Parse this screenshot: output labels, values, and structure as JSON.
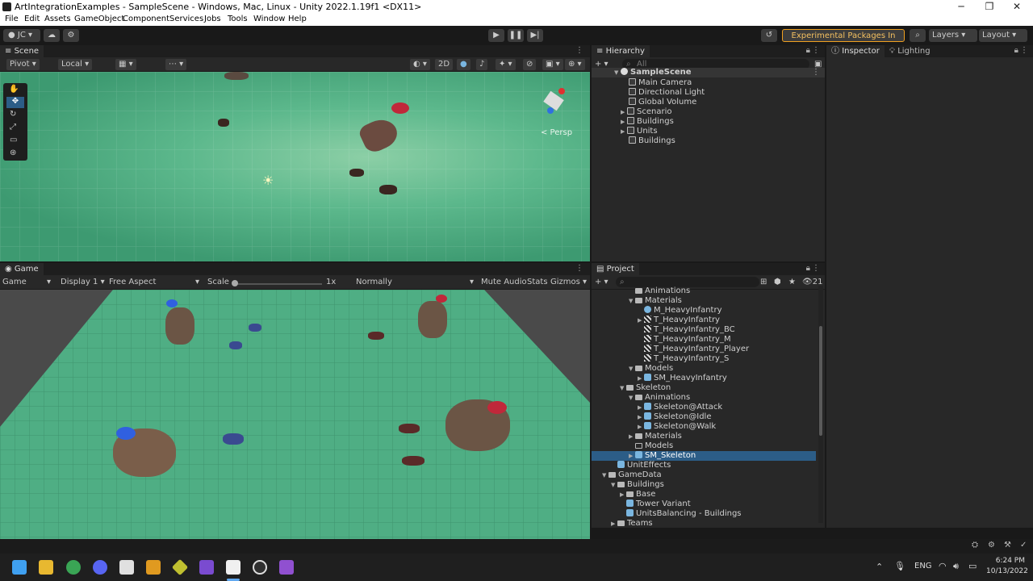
{
  "window": {
    "title": "ArtIntegrationExamples - SampleScene - Windows, Mac, Linux - Unity 2022.1.19f1 <DX11>",
    "minimize": "─",
    "maximize": "❐",
    "close": "✕"
  },
  "menu": [
    "File",
    "Edit",
    "Assets",
    "GameObject",
    "Component",
    "Services",
    "Jobs",
    "Tools",
    "Window",
    "Help"
  ],
  "toolbar": {
    "account": "JC",
    "experimental": "Experimental Packages In Use",
    "layers": "Layers",
    "layout": "Layout"
  },
  "scene": {
    "tab": "Scene",
    "pivot": "Pivot",
    "local": "Local",
    "mode_2d": "2D",
    "persp": "< Persp"
  },
  "game": {
    "tab": "Game",
    "mode": "Game",
    "display": "Display 1",
    "aspect": "Free Aspect",
    "scale_label": "Scale",
    "scale_value": "1x",
    "vsync": "Normally",
    "mute": "Mute Audio",
    "stats": "Stats",
    "gizmos": "Gizmos"
  },
  "hierarchy": {
    "tab": "Hierarchy",
    "search": "All",
    "scene": "SampleScene",
    "items": [
      "Main Camera",
      "Directional Light",
      "Global Volume",
      "Scenario",
      "Buildings",
      "Units",
      "Buildings"
    ]
  },
  "project": {
    "tab": "Project",
    "count": "21",
    "rows": [
      {
        "label": "Animations",
        "depth": 4,
        "icon": "folder",
        "arrow": ""
      },
      {
        "label": "Materials",
        "depth": 4,
        "icon": "folder",
        "arrow": "▼"
      },
      {
        "label": "M_HeavyInfantry",
        "depth": 5,
        "icon": "material",
        "arrow": ""
      },
      {
        "label": "T_HeavyInfantry",
        "depth": 5,
        "icon": "texture",
        "arrow": "▶"
      },
      {
        "label": "T_HeavyInfantry_BC",
        "depth": 5,
        "icon": "texture",
        "arrow": ""
      },
      {
        "label": "T_HeavyInfantry_M",
        "depth": 5,
        "icon": "texture",
        "arrow": ""
      },
      {
        "label": "T_HeavyInfantry_Player",
        "depth": 5,
        "icon": "texture",
        "arrow": ""
      },
      {
        "label": "T_HeavyInfantry_S",
        "depth": 5,
        "icon": "texture",
        "arrow": ""
      },
      {
        "label": "Models",
        "depth": 4,
        "icon": "folder",
        "arrow": "▼"
      },
      {
        "label": "SM_HeavyInfantry",
        "depth": 5,
        "icon": "prefab",
        "arrow": "▶"
      },
      {
        "label": "Skeleton",
        "depth": 3,
        "icon": "folder",
        "arrow": "▼"
      },
      {
        "label": "Animations",
        "depth": 4,
        "icon": "folder",
        "arrow": "▼"
      },
      {
        "label": "Skeleton@Attack",
        "depth": 5,
        "icon": "prefab",
        "arrow": "▶"
      },
      {
        "label": "Skeleton@Idle",
        "depth": 5,
        "icon": "prefab",
        "arrow": "▶"
      },
      {
        "label": "Skeleton@Walk",
        "depth": 5,
        "icon": "prefab",
        "arrow": "▶"
      },
      {
        "label": "Materials",
        "depth": 4,
        "icon": "folder",
        "arrow": "▶"
      },
      {
        "label": "Models",
        "depth": 4,
        "icon": "folder-open",
        "arrow": ""
      },
      {
        "label": "SM_Skeleton",
        "depth": 4,
        "icon": "prefab",
        "arrow": "▶"
      },
      {
        "label": "UnitEffects",
        "depth": 2,
        "icon": "prefab",
        "arrow": ""
      },
      {
        "label": "GameData",
        "depth": 1,
        "icon": "folder",
        "arrow": "▼"
      },
      {
        "label": "Buildings",
        "depth": 2,
        "icon": "folder",
        "arrow": "▼"
      },
      {
        "label": "Base",
        "depth": 3,
        "icon": "folder",
        "arrow": "▶"
      },
      {
        "label": "Tower Variant",
        "depth": 3,
        "icon": "prefab",
        "arrow": ""
      },
      {
        "label": "UnitsBalancing - Buildings",
        "depth": 3,
        "icon": "scriptable",
        "arrow": ""
      },
      {
        "label": "Teams",
        "depth": 2,
        "icon": "folder",
        "arrow": "▶"
      }
    ]
  },
  "inspector": {
    "tab": "Inspector",
    "lighting": "Lighting"
  },
  "taskbar": {
    "lang": "ENG",
    "time": "6:24 PM",
    "date": "10/13/2022"
  },
  "colors": {
    "ground": "#4fae84",
    "selection": "#2c5d87",
    "accent": "#f0a020"
  }
}
